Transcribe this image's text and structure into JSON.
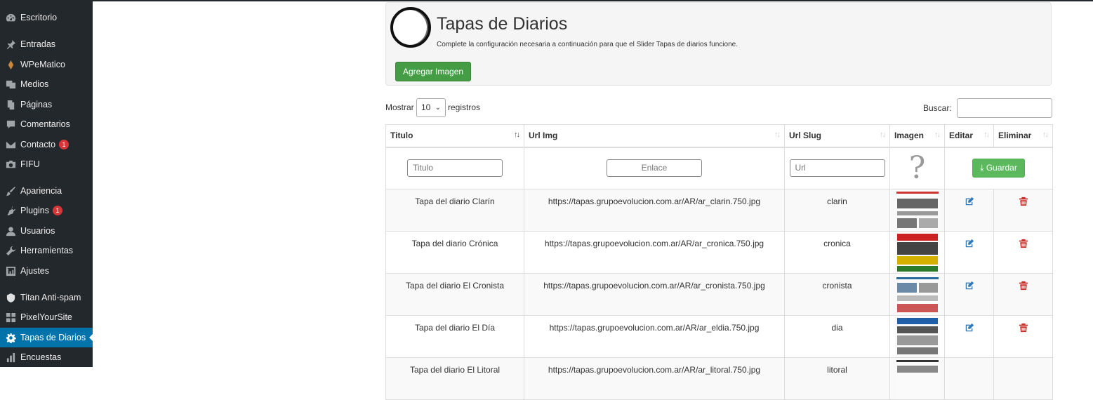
{
  "sidebar": {
    "items": [
      {
        "label": "Escritorio",
        "icon": "dashboard-icon"
      },
      {
        "label": "Entradas",
        "icon": "pin-icon"
      },
      {
        "label": "WPeMatico",
        "icon": "wpematico-icon"
      },
      {
        "label": "Medios",
        "icon": "media-icon"
      },
      {
        "label": "Páginas",
        "icon": "pages-icon"
      },
      {
        "label": "Comentarios",
        "icon": "comment-icon"
      },
      {
        "label": "Contacto",
        "icon": "mail-icon",
        "badge": "1"
      },
      {
        "label": "FIFU",
        "icon": "camera-icon"
      },
      {
        "label": "Apariencia",
        "icon": "brush-icon"
      },
      {
        "label": "Plugins",
        "icon": "plugin-icon",
        "badge": "1"
      },
      {
        "label": "Usuarios",
        "icon": "user-icon"
      },
      {
        "label": "Herramientas",
        "icon": "wrench-icon"
      },
      {
        "label": "Ajustes",
        "icon": "settings-icon"
      },
      {
        "label": "Titan Anti-spam",
        "icon": "shield-icon"
      },
      {
        "label": "PixelYourSite",
        "icon": "grid-icon"
      },
      {
        "label": "Tapas de Diarios",
        "icon": "gear-icon",
        "active": true
      },
      {
        "label": "Encuestas",
        "icon": "chart-icon"
      }
    ]
  },
  "header": {
    "title": "Tapas de Diarios",
    "subtitle": "Complete la configuración necesaria a continuación para que el Slider Tapas de diarios funcione.",
    "add_button": "Agregar Imagen"
  },
  "controls": {
    "show_label": "Mostrar",
    "show_value": "10",
    "show_suffix": "registros",
    "search_label": "Buscar:"
  },
  "table": {
    "headers": [
      "Titulo",
      "Url Img",
      "Url Slug",
      "Imagen",
      "Editar",
      "Eliminar"
    ],
    "filters": {
      "titulo_placeholder": "Titulo",
      "url_placeholder": "Enlace",
      "slug_placeholder": "Url",
      "save_button": "Guardar"
    },
    "rows": [
      {
        "titulo": "Tapa del diario Clarín",
        "url": "https://tapas.grupoevolucion.com.ar/AR/ar_clarin.750.jpg",
        "slug": "clarin"
      },
      {
        "titulo": "Tapa del diario Crónica",
        "url": "https://tapas.grupoevolucion.com.ar/AR/ar_cronica.750.jpg",
        "slug": "cronica"
      },
      {
        "titulo": "Tapa del diario El Cronista",
        "url": "https://tapas.grupoevolucion.com.ar/AR/ar_cronista.750.jpg",
        "slug": "cronista"
      },
      {
        "titulo": "Tapa del diario El Día",
        "url": "https://tapas.grupoevolucion.com.ar/AR/ar_eldia.750.jpg",
        "slug": "dia"
      },
      {
        "titulo": "Tapa del diario El Litoral",
        "url": "https://tapas.grupoevolucion.com.ar/AR/ar_litoral.750.jpg",
        "slug": "litoral"
      }
    ]
  },
  "colors": {
    "sidebar_bg": "#23282d",
    "active_bg": "#0073aa",
    "green_button": "#449d44",
    "edit_icon": "#337ab7",
    "delete_icon": "#d9534f"
  }
}
